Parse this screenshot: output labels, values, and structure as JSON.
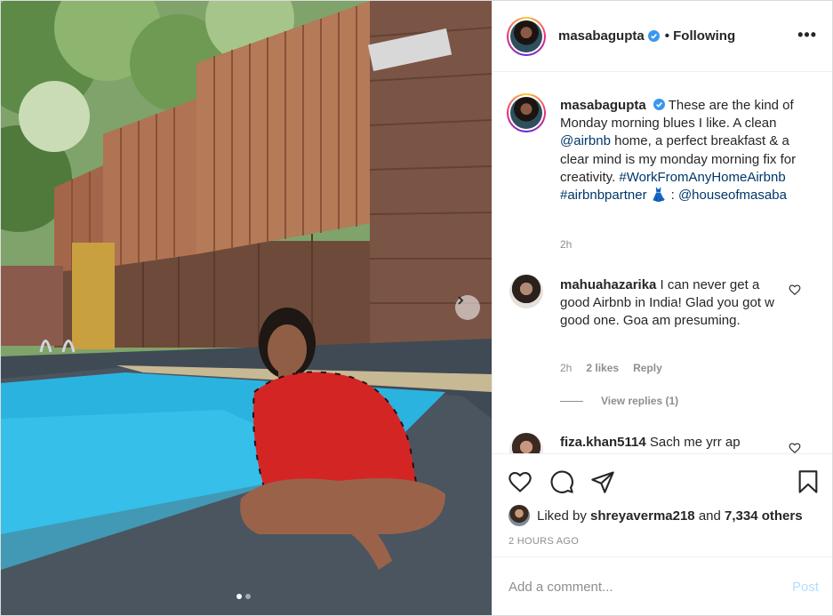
{
  "post": {
    "username": "masabagupta",
    "following_label": "Following",
    "more_label": "•••",
    "caption_username": "masabagupta",
    "caption_part1": " These are the kind of Monday morning blues I like. A clean ",
    "caption_mention1": "@airbnb",
    "caption_part2": " home, a perfect breakfast & a clear mind is my monday morning fix for creativity. ",
    "caption_hashtag1": "#WorkFromAnyHomeAirbnb",
    "caption_hashtag2": "#airbnbpartner",
    "caption_emoji": " 👗 : ",
    "caption_mention2": "@houseofmasaba",
    "caption_time": "2h"
  },
  "comments": [
    {
      "username": "mahuahazarika",
      "text": " I can never get a good Airbnb in India! Glad you got w good one. Goa am presuming.",
      "time": "2h",
      "likes": "2 likes",
      "reply_label": "Reply",
      "view_replies": "View replies (1)"
    },
    {
      "username": "fiza.khan5114",
      "text": " Sach me yrr ap"
    }
  ],
  "actions": {
    "liked_by_prefix": "Liked by ",
    "liked_by_user": "shreyaverma218",
    "liked_by_and": " and ",
    "liked_by_others": "7,334 others",
    "posted_time": "2 HOURS AGO"
  },
  "add_comment": {
    "placeholder": "Add a comment...",
    "post_label": "Post"
  },
  "carousel": {
    "slide_count": 2,
    "active_index": 0
  },
  "colors": {
    "link": "#00376b",
    "post_button": "#b2dffc",
    "verified": "#3897f0",
    "muted": "#8e8e8e"
  },
  "icons": [
    "heart-icon",
    "comment-icon",
    "share-icon",
    "bookmark-icon",
    "verified-icon",
    "chevron-right-icon",
    "more-icon"
  ]
}
